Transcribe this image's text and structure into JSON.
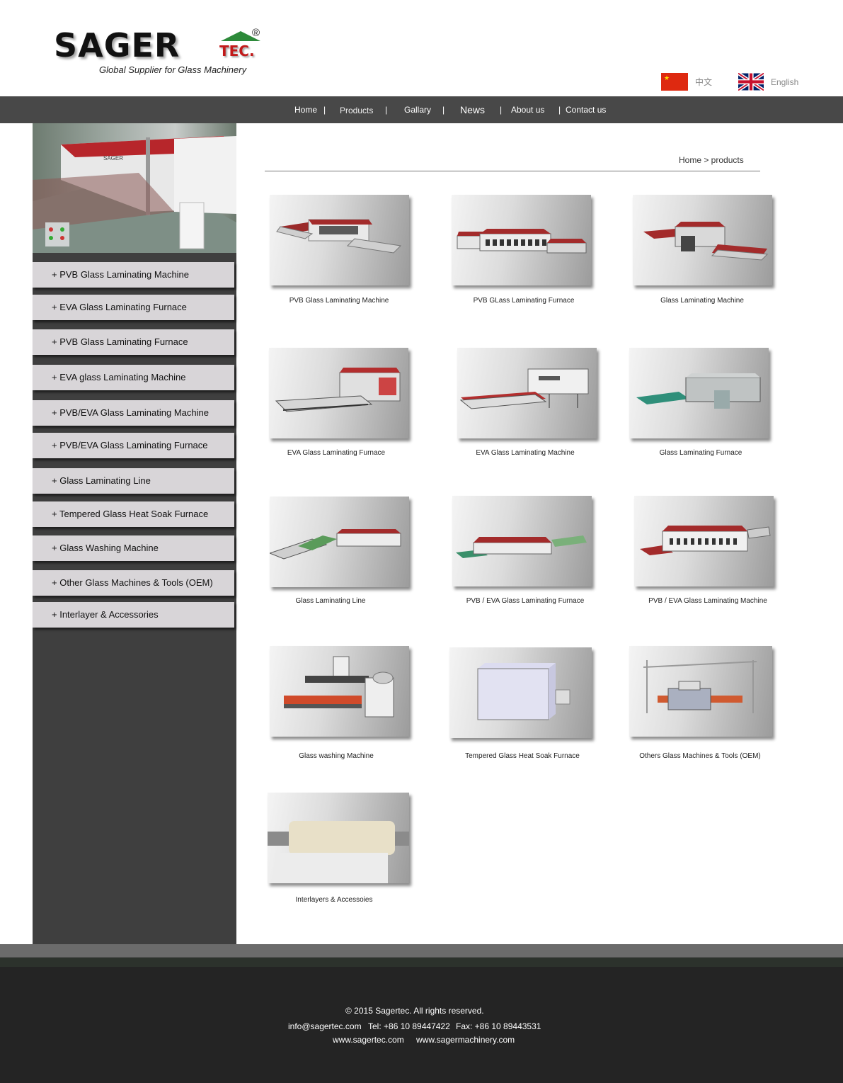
{
  "brand": {
    "name_black": "SAGER",
    "name_suffix": "TEC.",
    "registered": "®",
    "tagline": "Global Supplier for Glass Machinery"
  },
  "languages": [
    {
      "label": "中文",
      "flag": "china-flag-icon"
    },
    {
      "label": "English",
      "flag": "uk-flag-icon"
    }
  ],
  "nav": {
    "items": [
      "Home",
      "Products",
      "Gallary",
      "News",
      "About us",
      "Contact us"
    ],
    "separator": "|"
  },
  "breadcrumb": "Home > products",
  "sidebar": {
    "items": [
      "+ PVB Glass Laminating Machine",
      "+ EVA Glass Laminating Furnace",
      "+ PVB Glass Laminating Furnace",
      "+ EVA glass Laminating Machine",
      "+ PVB/EVA Glass Laminating Machine",
      "+ PVB/EVA Glass Laminating Furnace",
      "+ Glass Laminating Line",
      "+ Tempered Glass Heat Soak Furnace",
      "+ Glass Washing Machine",
      "+ Other Glass Machines & Tools (OEM)",
      "+ Interlayer & Accessories"
    ]
  },
  "products": [
    "PVB Glass Laminating Machine",
    "PVB GLass Laminating Furnace",
    "Glass Laminating Machine",
    "EVA Glass Laminating Furnace",
    "EVA Glass Laminating Machine",
    "Glass Laminating Furnace",
    "Glass Laminating Line",
    "PVB / EVA Glass Laminating Furnace",
    "PVB / EVA Glass Laminating Machine",
    "Glass washing Machine",
    "Tempered Glass Heat Soak Furnace",
    "Others Glass Machines & Tools (OEM)",
    "Interlayers & Accessoies"
  ],
  "footer": {
    "copyright": "© 2015  Sagertec. All rights reserved.",
    "email": "info@sagertec.com",
    "tel": "Tel: +86 10 89447422",
    "fax": "Fax: +86 10 89443531",
    "site1": "www.sagertec.com",
    "site2": "www.sagermachinery.com"
  },
  "colors": {
    "nav_bg": "#484848",
    "sidebar_bg": "#3f3f3f",
    "sidebar_item_bg": "#d8d5d8",
    "footer_bg": "#242424",
    "brand_red": "#c21a1a",
    "brand_green": "#2d8a3a"
  }
}
